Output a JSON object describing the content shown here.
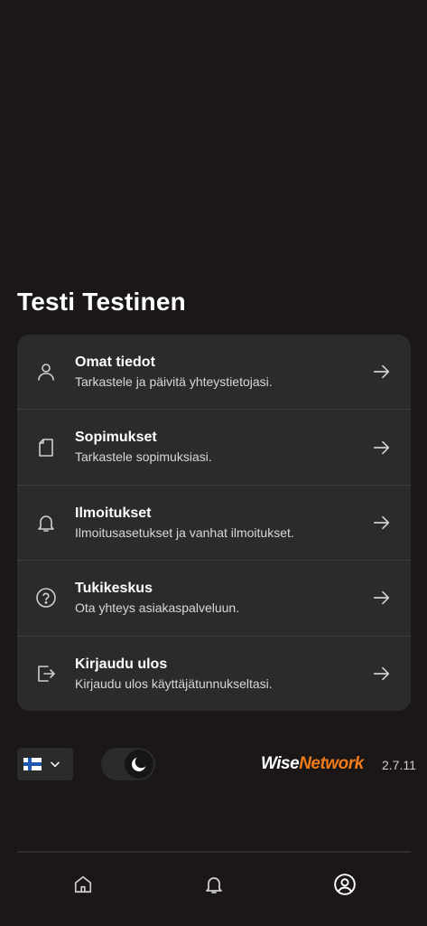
{
  "header": {
    "title": "Testi Testinen"
  },
  "menu": {
    "items": [
      {
        "title": "Omat tiedot",
        "subtitle": "Tarkastele ja päivitä yhteystietojasi.",
        "icon": "user-icon"
      },
      {
        "title": "Sopimukset",
        "subtitle": "Tarkastele sopimuksiasi.",
        "icon": "document-icon"
      },
      {
        "title": "Ilmoitukset",
        "subtitle": "Ilmoitusasetukset ja vanhat ilmoitukset.",
        "icon": "bell-icon"
      },
      {
        "title": "Tukikeskus",
        "subtitle": "Ota yhteys asiakaspalveluun.",
        "icon": "help-icon"
      },
      {
        "title": "Kirjaudu ulos",
        "subtitle": "Kirjaudu ulos käyttäjätunnukseltasi.",
        "icon": "logout-icon"
      }
    ]
  },
  "footer": {
    "language_flag": "finland-flag-icon",
    "theme_mode_icon": "moon-icon",
    "brand_part1": "Wise",
    "brand_part2": "Network",
    "version": "2.7.11"
  },
  "bottom_nav": {
    "items": [
      {
        "icon": "home-icon"
      },
      {
        "icon": "bell-icon"
      },
      {
        "icon": "profile-icon",
        "active": true
      }
    ]
  },
  "colors": {
    "background": "#1a1716",
    "card": "#2b2b2b",
    "brand_accent": "#f27b1a"
  }
}
